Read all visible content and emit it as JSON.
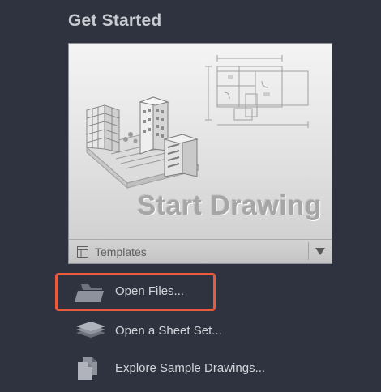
{
  "section": {
    "title": "Get Started"
  },
  "start_card": {
    "label": "Start Drawing",
    "templates_label": "Templates",
    "templates_icon": "templates-grid-icon",
    "dropdown_icon": "triangle-down-icon"
  },
  "actions": [
    {
      "label": "Open Files...",
      "icon": "folder-icon"
    },
    {
      "label": "Open a Sheet Set...",
      "icon": "sheet-set-stack-icon"
    },
    {
      "label": "Explore Sample Drawings...",
      "icon": "sample-drawings-icon"
    }
  ],
  "colors": {
    "background": "#2e333f",
    "highlight": "#ea5a3c",
    "text": "#d3d5da"
  }
}
